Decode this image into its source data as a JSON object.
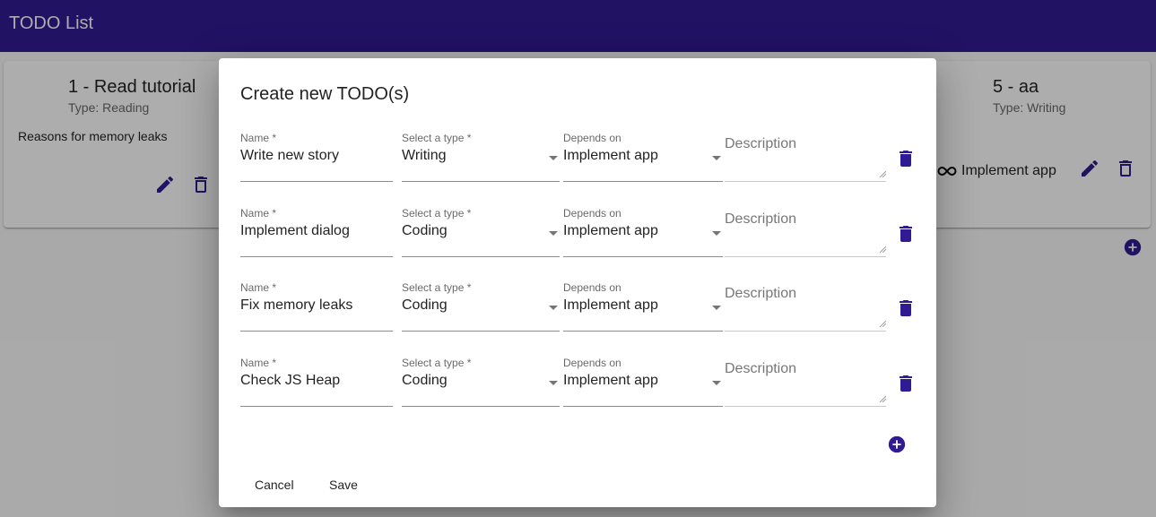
{
  "app": {
    "title": "TODO List"
  },
  "colors": {
    "primary": "#311b92",
    "icon": "#311b92"
  },
  "cards": [
    {
      "title": "1 - Read tutorial",
      "type": "Type: Reading",
      "description": "Reasons for memory leaks",
      "actions": [
        "edit-icon",
        "delete-icon"
      ]
    },
    {
      "title": "5 - aa",
      "type": "Type: Writing",
      "depends_on": "Implement app",
      "depends_icon": "infinity-icon",
      "actions": [
        "edit-icon",
        "delete-icon"
      ]
    }
  ],
  "page": {
    "add_icon": "add-circle-icon"
  },
  "dialog": {
    "title": "Create new TODO(s)",
    "labels": {
      "name": "Name *",
      "type": "Select a type *",
      "depends": "Depends on",
      "description": "Description"
    },
    "rows": [
      {
        "name": "Write new story",
        "type": "Writing",
        "depends": "Implement app",
        "description": ""
      },
      {
        "name": "Implement dialog",
        "type": "Coding",
        "depends": "Implement app",
        "description": ""
      },
      {
        "name": "Fix memory leaks",
        "type": "Coding",
        "depends": "Implement app",
        "description": ""
      },
      {
        "name": "Check JS Heap",
        "type": "Coding",
        "depends": "Implement app",
        "description": ""
      }
    ],
    "add_icon": "add-circle-icon",
    "buttons": {
      "cancel": "Cancel",
      "save": "Save"
    }
  }
}
